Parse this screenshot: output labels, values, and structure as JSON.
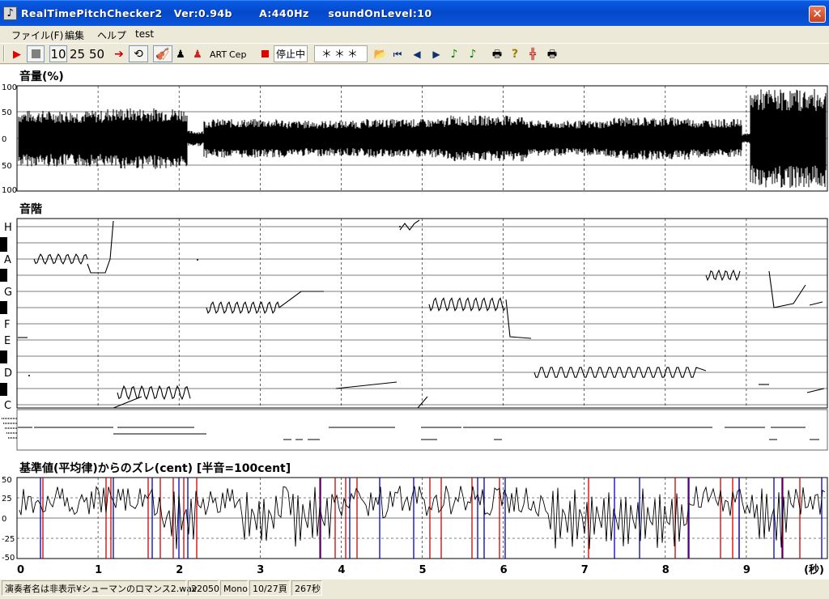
{
  "window": {
    "title": "RealTimePitchChecker2   Ver:0.94b       A:440Hz     soundOnLevel:10",
    "close_label": "✕"
  },
  "menu": [
    "ファイル(F)",
    "編集",
    "ヘルプ",
    "test"
  ],
  "toolbar": {
    "num10": "10",
    "num25": "25",
    "num50": "50",
    "art": "ART",
    "cep": "Cep",
    "stop_status": "停止中",
    "note_display": "＊＊＊"
  },
  "volume": {
    "label": "音量(%)",
    "ticks": [
      "100",
      "50",
      "0",
      "50",
      "100"
    ]
  },
  "scale": {
    "label": "音階",
    "notes": [
      "H",
      "A",
      "G",
      "F",
      "E",
      "D",
      "C"
    ]
  },
  "deviation": {
    "label": "基準値(平均律)からのズレ(cent) [半音=100cent]",
    "ticks": [
      "50",
      "25",
      "0",
      "-25",
      "-50"
    ]
  },
  "time_axis": {
    "ticks": [
      "0",
      "1",
      "2",
      "3",
      "4",
      "5",
      "6",
      "7",
      "8",
      "9"
    ],
    "unit": "(秒)"
  },
  "status": {
    "file": "演奏者名は非表示¥シューマンのロマンス2.wav",
    "rate": "22050",
    "channels": "Mono",
    "page": "10/27頁",
    "duration": "267秒"
  },
  "colors": {
    "titlebar": "#0548c8",
    "panel": "#ece9d8",
    "trace": "#000000",
    "dev_red": "#d00000",
    "dev_blue": "#0000c0"
  }
}
